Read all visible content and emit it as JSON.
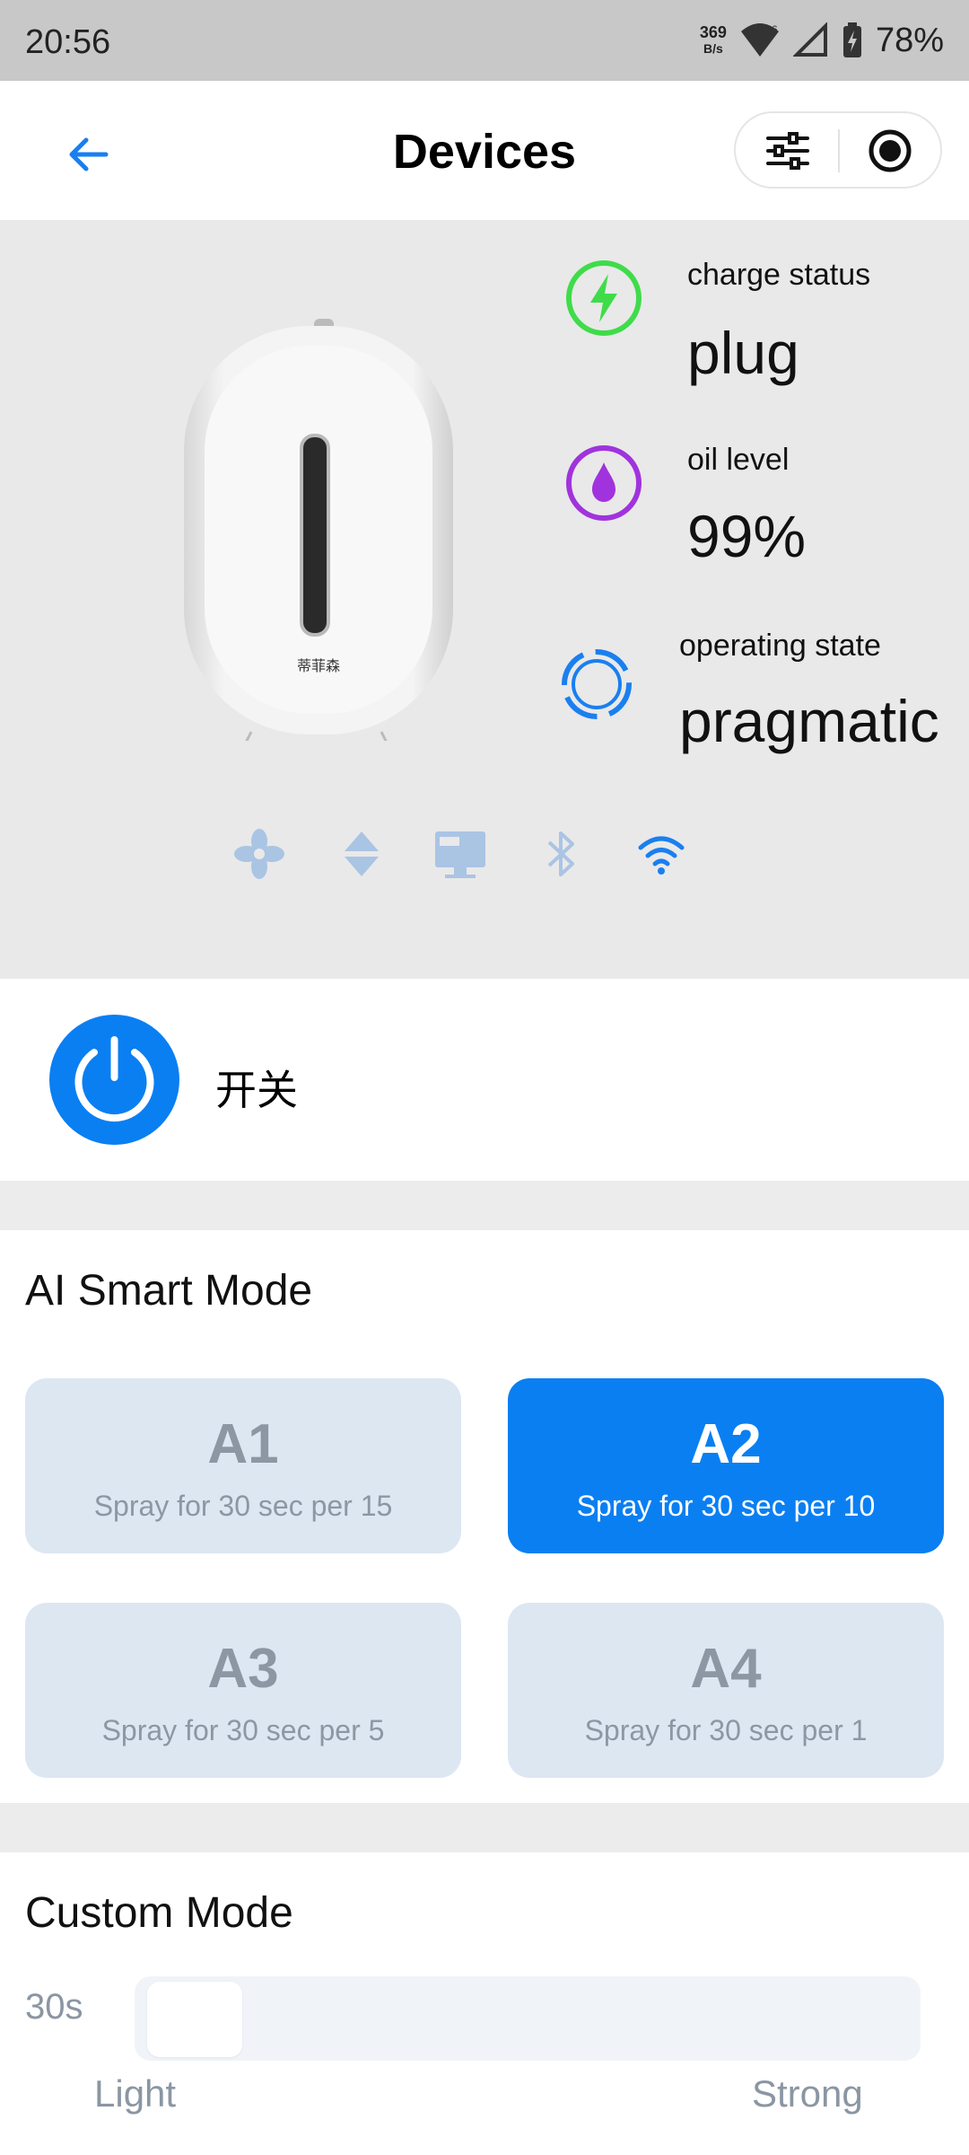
{
  "status_bar": {
    "time": "20:56",
    "net_speed_value": "369",
    "net_speed_unit": "B/s",
    "battery": "78%"
  },
  "header": {
    "title": "Devices"
  },
  "device": {
    "brand_label": "蒂菲森",
    "stats": [
      {
        "label": "charge status",
        "value": "plug",
        "icon": "lightning-icon",
        "color": "#3fdc4a"
      },
      {
        "label": "oil level",
        "value": "99%",
        "icon": "oil-drop-icon",
        "color": "#a033dd"
      },
      {
        "label": "operating state",
        "value": "pragmatic",
        "icon": "operating-ring-icon",
        "color": "#1a7ff0"
      }
    ],
    "feature_icons": [
      "fan-icon",
      "up-down-icon",
      "display-icon",
      "bluetooth-icon",
      "wifi-icon"
    ]
  },
  "power": {
    "label": "开关",
    "color": "#0a7ff2"
  },
  "ai_mode": {
    "title": "AI Smart Mode",
    "modes": [
      {
        "name": "A1",
        "desc": "Spray for 30 sec per 15",
        "active": false
      },
      {
        "name": "A2",
        "desc": "Spray for 30 sec per 10",
        "active": true
      },
      {
        "name": "A3",
        "desc": "Spray for 30 sec per 5",
        "active": false
      },
      {
        "name": "A4",
        "desc": "Spray for 30 sec per 1",
        "active": false
      }
    ]
  },
  "custom_mode": {
    "title": "Custom Mode",
    "value": "30s",
    "level_fraction": 0.02,
    "min_label": "Light",
    "max_label": "Strong"
  }
}
